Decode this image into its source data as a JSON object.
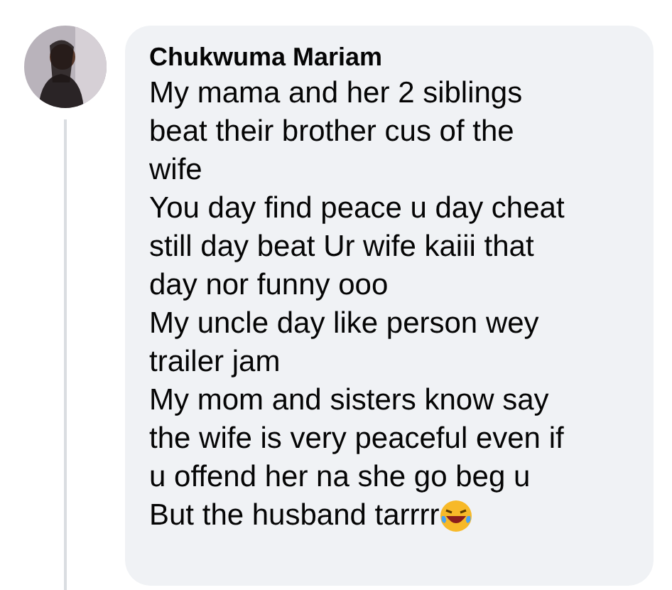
{
  "comment": {
    "author": "Chukwuma Mariam",
    "lines": [
      "My mama and her 2 siblings",
      "beat their brother cus of the",
      "wife",
      "You day find peace u day cheat",
      "still day beat Ur wife kaiii that",
      "day nor funny ooo",
      "My uncle day like person wey",
      "trailer jam",
      "My mom and sisters know say",
      "the wife is very peaceful even if",
      "u offend her na she go beg u",
      "But the husband tarrrr"
    ]
  }
}
